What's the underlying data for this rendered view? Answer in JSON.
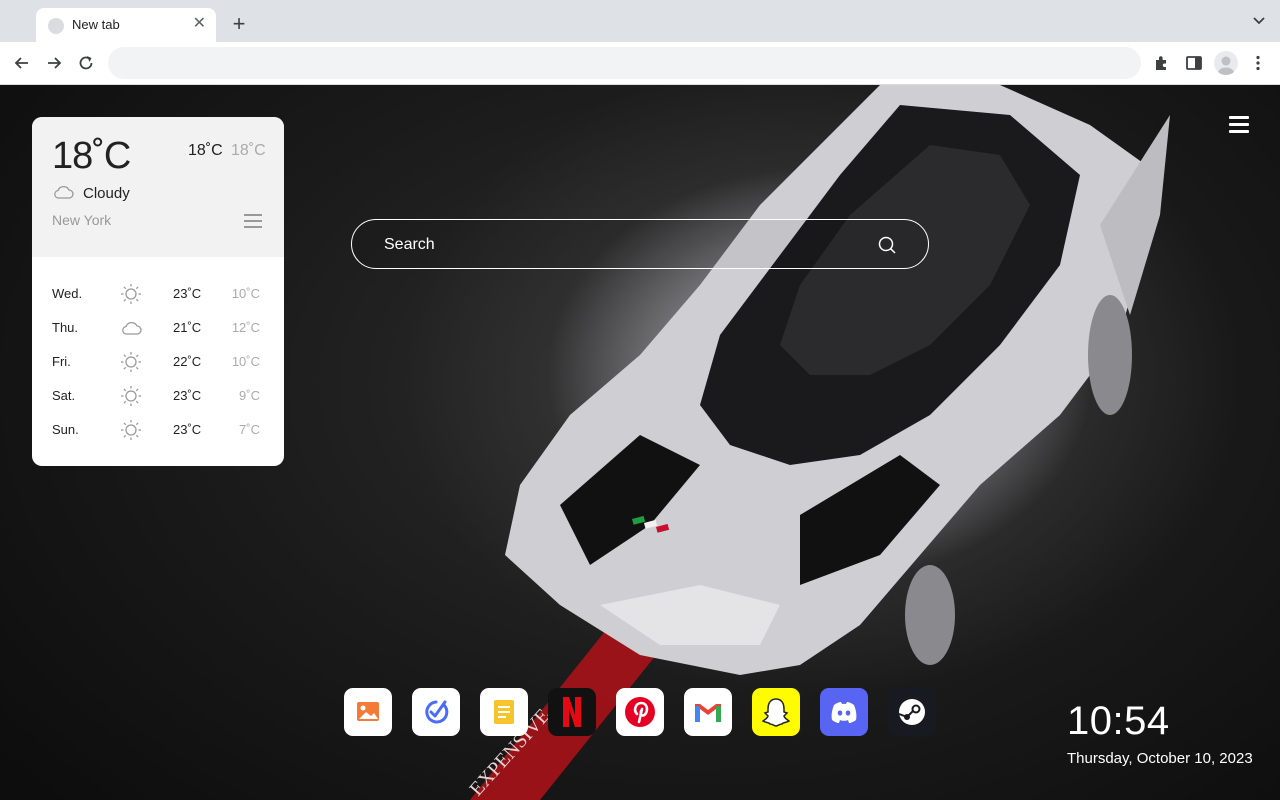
{
  "browser": {
    "tab_title": "New tab",
    "tab_close": "✕",
    "new_tab": "+"
  },
  "toolbar": {
    "back_icon": "back-arrow-icon",
    "forward_icon": "forward-arrow-icon",
    "reload_icon": "reload-icon",
    "address_value": "",
    "extensions_icon": "puzzle-icon",
    "side_panel_icon": "side-panel-icon",
    "menu_icon": "kebab-menu-icon"
  },
  "weather": {
    "current_temp": "18˚C",
    "high": "18˚C",
    "low": "18˚C",
    "condition": "Cloudy",
    "condition_icon": "cloud-icon",
    "city": "New York",
    "forecast": [
      {
        "day": "Wed.",
        "icon": "sun-icon",
        "high": "23˚C",
        "low": "10˚C"
      },
      {
        "day": "Thu.",
        "icon": "cloud-icon",
        "high": "21˚C",
        "low": "12˚C"
      },
      {
        "day": "Fri.",
        "icon": "sun-icon",
        "high": "22˚C",
        "low": "10˚C"
      },
      {
        "day": "Sat.",
        "icon": "sun-icon",
        "high": "23˚C",
        "low": "9˚C"
      },
      {
        "day": "Sun.",
        "icon": "sun-icon",
        "high": "23˚C",
        "low": "7˚C"
      }
    ]
  },
  "search": {
    "placeholder": "Search"
  },
  "dock": [
    {
      "name": "photos",
      "icon": "image-icon"
    },
    {
      "name": "tasks",
      "icon": "checkmark-icon"
    },
    {
      "name": "notes",
      "icon": "notes-icon"
    },
    {
      "name": "netflix",
      "icon": "netflix-icon"
    },
    {
      "name": "pinterest",
      "icon": "pinterest-icon"
    },
    {
      "name": "gmail",
      "icon": "gmail-icon"
    },
    {
      "name": "snapchat",
      "icon": "snapchat-icon"
    },
    {
      "name": "discord",
      "icon": "discord-icon"
    },
    {
      "name": "steam",
      "icon": "steam-icon"
    }
  ],
  "clock": {
    "time": "10:54",
    "date": "Thursday, October 10, 2023"
  },
  "background": {
    "stripe_text": "EXPENSIVE"
  },
  "colors": {
    "netflix_red": "#e50914",
    "pinterest_red": "#e60023",
    "snapchat_yellow": "#fffc00",
    "discord_blurple": "#5865f2",
    "steam_dark": "#171a21"
  }
}
